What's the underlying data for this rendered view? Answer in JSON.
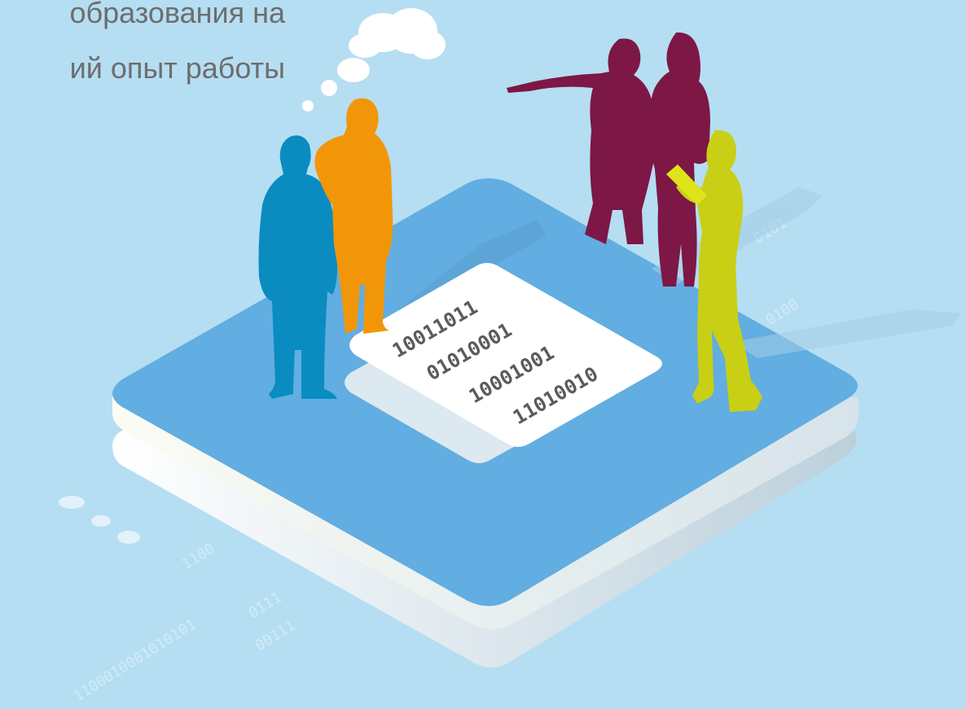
{
  "heading": {
    "line1": "образования на",
    "line2": "ий опыт работы"
  },
  "document_binary": [
    "10011011",
    "01010001",
    "10001001",
    "11010010"
  ],
  "bg_binary": [
    "1100",
    "0111",
    "00111",
    "1100010001010101",
    "0101",
    "0100"
  ],
  "colors": {
    "background": "#b5def2",
    "platform_top": "#62ade1",
    "platform_side": "#f4f6ec",
    "person_blue": "#0a8cc0",
    "person_orange": "#f29609",
    "person_maroon": "#7d1746",
    "person_lime": "#c9cf14",
    "text": "#6d6d6d"
  },
  "icons": [
    "thought-cloud-icon",
    "binary-document-icon"
  ]
}
